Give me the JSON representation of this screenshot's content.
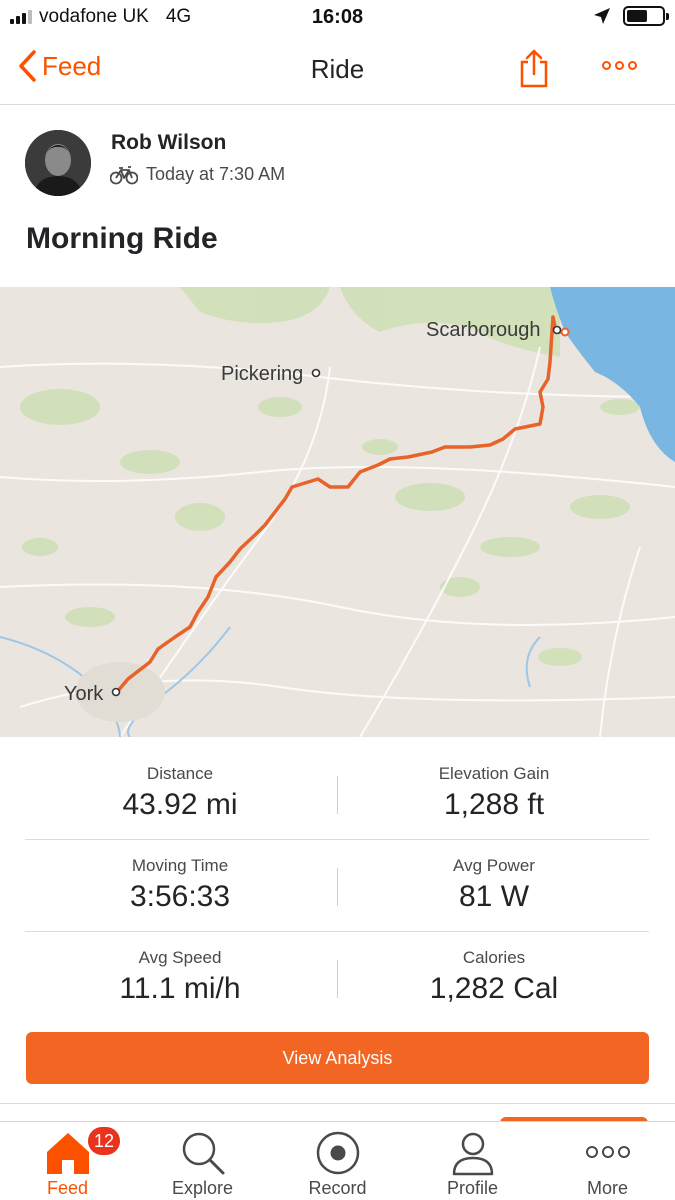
{
  "status_bar": {
    "carrier": "vodafone UK",
    "network": "4G",
    "time": "16:08"
  },
  "nav": {
    "back_label": "Feed",
    "title": "Ride",
    "share_icon": "share-icon",
    "more_icon": "more-dots-icon"
  },
  "activity": {
    "athlete_name": "Rob Wilson",
    "sport_icon": "bike-icon",
    "timestamp": "Today at 7:30 AM",
    "title": "Morning Ride"
  },
  "map": {
    "labels": {
      "scarborough": "Scarborough",
      "pickering": "Pickering",
      "york": "York"
    },
    "route_color": "#e8622a",
    "land_color": "#eae6df",
    "water_color": "#79b6e2"
  },
  "stats": {
    "distance": {
      "label": "Distance",
      "value": "43.92 mi"
    },
    "elevation": {
      "label": "Elevation Gain",
      "value": "1,288 ft"
    },
    "moving_time": {
      "label": "Moving Time",
      "value": "3:56:33"
    },
    "avg_power": {
      "label": "Avg Power",
      "value": "81 W"
    },
    "avg_speed": {
      "label": "Avg Speed",
      "value": "11.1 mi/h"
    },
    "calories": {
      "label": "Calories",
      "value": "1,282 Cal"
    }
  },
  "actions": {
    "view_analysis": "View Analysis"
  },
  "tab_bar": {
    "feed": {
      "label": "Feed",
      "badge": "12",
      "icon": "home-icon"
    },
    "explore": {
      "label": "Explore",
      "icon": "search-icon"
    },
    "record": {
      "label": "Record",
      "icon": "record-icon"
    },
    "profile": {
      "label": "Profile",
      "icon": "profile-icon"
    },
    "more": {
      "label": "More",
      "icon": "more-dots-icon"
    }
  },
  "colors": {
    "accent": "#fc5200",
    "button": "#f26522",
    "badge": "#e9331d"
  }
}
